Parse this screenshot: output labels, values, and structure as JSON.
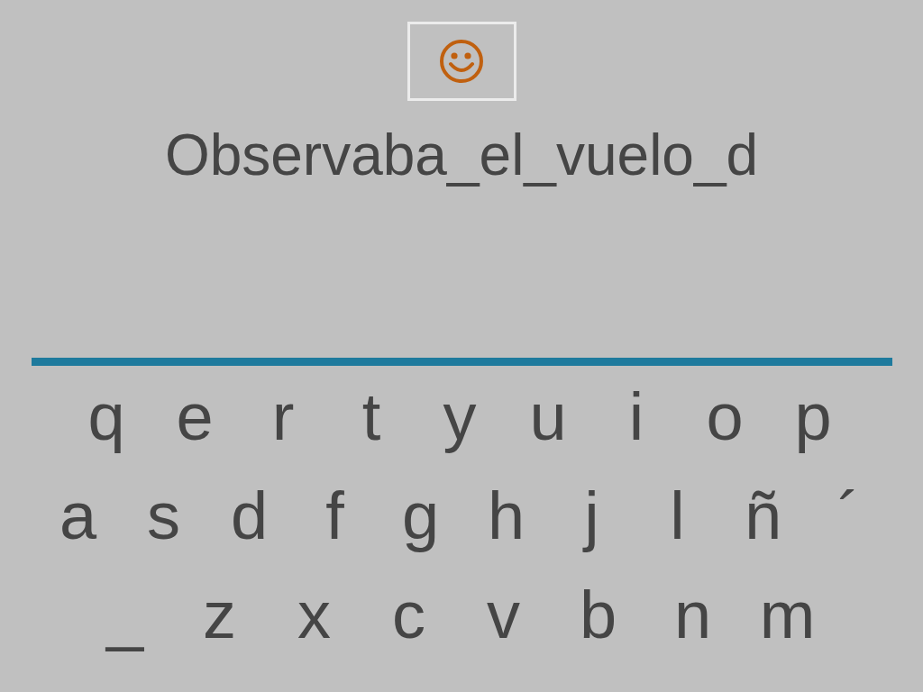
{
  "phrase": "Observaba_el_vuelo_d",
  "keyboard": {
    "rows": [
      [
        "q",
        "e",
        "r",
        "t",
        "y",
        "u",
        "i",
        "o",
        "p"
      ],
      [
        "a",
        "s",
        "d",
        "f",
        "g",
        "h",
        "j",
        "l",
        "ñ",
        "´"
      ],
      [
        "_",
        "z",
        "x",
        "c",
        "v",
        "b",
        "n",
        "m"
      ]
    ]
  }
}
